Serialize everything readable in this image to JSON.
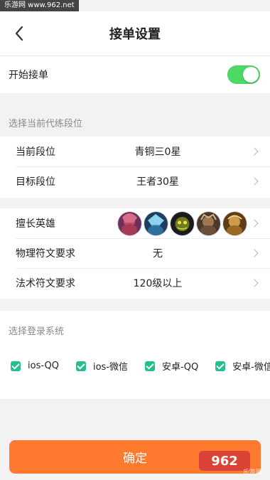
{
  "watermark": {
    "top": "乐游网 www.962.net",
    "bottom_logo": "962",
    "bottom_text": "乐游网"
  },
  "header": {
    "title": "接单设置",
    "back_icon": "chevron-left-icon"
  },
  "toggle": {
    "label": "开始接单",
    "enabled": true,
    "color": "#4cd964"
  },
  "rank_section": {
    "title": "选择当前代练段位",
    "rows": [
      {
        "label": "当前段位",
        "value": "青铜三0星",
        "icon": "chevron-right-icon"
      },
      {
        "label": "目标段位",
        "value": "王者30星",
        "icon": "chevron-right-icon"
      }
    ]
  },
  "hero_section": {
    "rows": [
      {
        "label": "擅长英雄",
        "heroes": [
          "hero-avatar-1",
          "hero-avatar-2",
          "hero-avatar-3",
          "hero-avatar-4",
          "hero-avatar-5"
        ],
        "icon": "chevron-right-icon"
      },
      {
        "label": "物理符文要求",
        "value": "无",
        "icon": "chevron-right-icon"
      },
      {
        "label": "法术符文要求",
        "value": "120级以上",
        "icon": "chevron-right-icon"
      }
    ]
  },
  "login_section": {
    "title": "选择登录系统",
    "options": [
      {
        "label": "ios-QQ",
        "checked": true
      },
      {
        "label": "ios-微信",
        "checked": true
      },
      {
        "label": "安卓-QQ",
        "checked": true
      },
      {
        "label": "安卓-微信",
        "checked": true
      }
    ]
  },
  "confirm_button": {
    "label": "确定",
    "color": "#ff7a2f"
  }
}
